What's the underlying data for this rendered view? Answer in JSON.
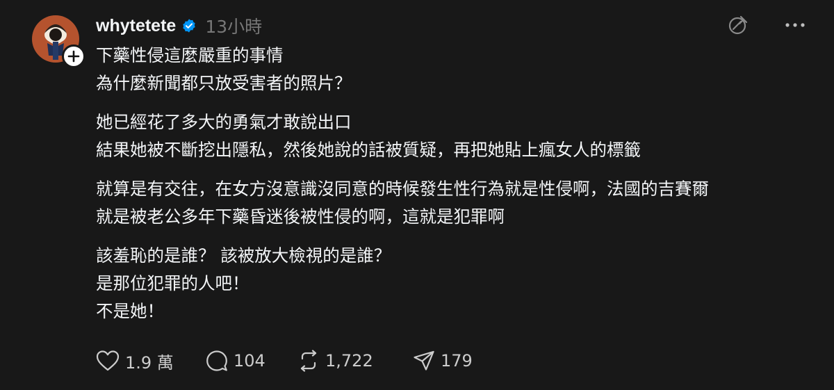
{
  "post": {
    "username": "whytetete",
    "timestamp": "13小時",
    "paragraphs": [
      {
        "lines": [
          "下藥性侵這麼嚴重的事情",
          "為什麼新聞都只放受害者的照片？"
        ]
      },
      {
        "lines": [
          "她已經花了多大的勇氣才敢說出口",
          "結果她被不斷挖出隱私，然後她說的話被質疑，再把她貼上瘋女人的標籤"
        ]
      },
      {
        "lines": [
          "就算是有交往，在女方沒意識沒同意的時候發生性行為就是性侵啊，法國的吉賽爾",
          "就是被老公多年下藥昏迷後被性侵的啊，這就是犯罪啊"
        ]
      },
      {
        "lines": [
          "該羞恥的是誰？ 該被放大檢視的是誰？",
          "是那位犯罪的人吧！",
          "不是她！"
        ]
      }
    ],
    "actions": {
      "likes": "1.9 萬",
      "comments": "104",
      "reposts": "1,722",
      "shares": "179"
    }
  },
  "icons": {
    "verified": "verified-badge-icon",
    "follow": "plus-icon",
    "translate": "translate-icon",
    "more": "more-icon",
    "like": "heart-icon",
    "comment": "comment-icon",
    "repost": "repost-icon",
    "share": "share-icon"
  },
  "colors": {
    "background": "#181818",
    "text": "#f3f5f7",
    "muted": "#777777",
    "verified": "#0095f6"
  }
}
